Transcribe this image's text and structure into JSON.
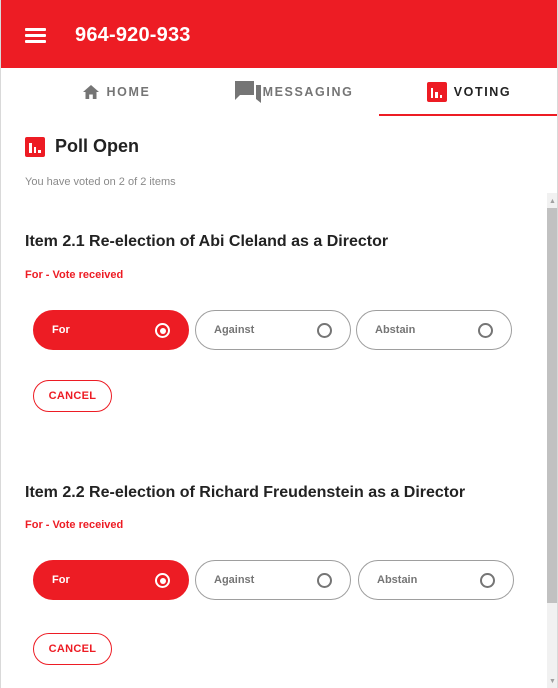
{
  "header": {
    "title": "964-920-933"
  },
  "tabs": [
    {
      "label": "HOME",
      "icon": "home-icon"
    },
    {
      "label": "MESSAGING",
      "icon": "messaging-icon"
    },
    {
      "label": "VOTING",
      "icon": "voting-icon",
      "active": true
    }
  ],
  "poll": {
    "title": "Poll Open",
    "subtitle": "You have voted on 2 of 2 items"
  },
  "items": [
    {
      "title": "Item 2.1 Re-election of Abi Cleland as a Director",
      "status": "For - Vote received",
      "options": [
        {
          "label": "For",
          "selected": true
        },
        {
          "label": "Against",
          "selected": false
        },
        {
          "label": "Abstain",
          "selected": false
        }
      ],
      "cancel_label": "CANCEL"
    },
    {
      "title": "Item 2.2 Re-election of Richard Freudenstein as a Director",
      "status": "For - Vote received",
      "options": [
        {
          "label": "For",
          "selected": true
        },
        {
          "label": "Against",
          "selected": false
        },
        {
          "label": "Abstain",
          "selected": false
        }
      ],
      "cancel_label": "CANCEL"
    }
  ],
  "colors": {
    "accent": "#ed1c24",
    "muted_text": "#757575"
  }
}
